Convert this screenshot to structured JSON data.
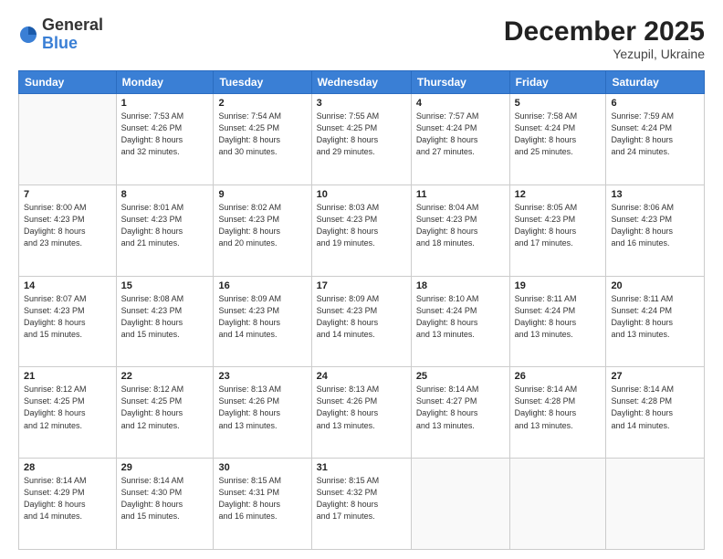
{
  "header": {
    "logo_general": "General",
    "logo_blue": "Blue",
    "month": "December 2025",
    "location": "Yezupil, Ukraine"
  },
  "days_of_week": [
    "Sunday",
    "Monday",
    "Tuesday",
    "Wednesday",
    "Thursday",
    "Friday",
    "Saturday"
  ],
  "weeks": [
    [
      {
        "day": "",
        "info": ""
      },
      {
        "day": "1",
        "info": "Sunrise: 7:53 AM\nSunset: 4:26 PM\nDaylight: 8 hours\nand 32 minutes."
      },
      {
        "day": "2",
        "info": "Sunrise: 7:54 AM\nSunset: 4:25 PM\nDaylight: 8 hours\nand 30 minutes."
      },
      {
        "day": "3",
        "info": "Sunrise: 7:55 AM\nSunset: 4:25 PM\nDaylight: 8 hours\nand 29 minutes."
      },
      {
        "day": "4",
        "info": "Sunrise: 7:57 AM\nSunset: 4:24 PM\nDaylight: 8 hours\nand 27 minutes."
      },
      {
        "day": "5",
        "info": "Sunrise: 7:58 AM\nSunset: 4:24 PM\nDaylight: 8 hours\nand 25 minutes."
      },
      {
        "day": "6",
        "info": "Sunrise: 7:59 AM\nSunset: 4:24 PM\nDaylight: 8 hours\nand 24 minutes."
      }
    ],
    [
      {
        "day": "7",
        "info": ""
      },
      {
        "day": "8",
        "info": "Sunrise: 8:01 AM\nSunset: 4:23 PM\nDaylight: 8 hours\nand 21 minutes."
      },
      {
        "day": "9",
        "info": "Sunrise: 8:02 AM\nSunset: 4:23 PM\nDaylight: 8 hours\nand 20 minutes."
      },
      {
        "day": "10",
        "info": "Sunrise: 8:03 AM\nSunset: 4:23 PM\nDaylight: 8 hours\nand 19 minutes."
      },
      {
        "day": "11",
        "info": "Sunrise: 8:04 AM\nSunset: 4:23 PM\nDaylight: 8 hours\nand 18 minutes."
      },
      {
        "day": "12",
        "info": "Sunrise: 8:05 AM\nSunset: 4:23 PM\nDaylight: 8 hours\nand 17 minutes."
      },
      {
        "day": "13",
        "info": "Sunrise: 8:06 AM\nSunset: 4:23 PM\nDaylight: 8 hours\nand 16 minutes."
      }
    ],
    [
      {
        "day": "14",
        "info": "Sunrise: 8:07 AM\nSunset: 4:23 PM\nDaylight: 8 hours\nand 15 minutes."
      },
      {
        "day": "15",
        "info": "Sunrise: 8:08 AM\nSunset: 4:23 PM\nDaylight: 8 hours\nand 15 minutes."
      },
      {
        "day": "16",
        "info": "Sunrise: 8:09 AM\nSunset: 4:23 PM\nDaylight: 8 hours\nand 14 minutes."
      },
      {
        "day": "17",
        "info": "Sunrise: 8:09 AM\nSunset: 4:23 PM\nDaylight: 8 hours\nand 14 minutes."
      },
      {
        "day": "18",
        "info": "Sunrise: 8:10 AM\nSunset: 4:24 PM\nDaylight: 8 hours\nand 13 minutes."
      },
      {
        "day": "19",
        "info": "Sunrise: 8:11 AM\nSunset: 4:24 PM\nDaylight: 8 hours\nand 13 minutes."
      },
      {
        "day": "20",
        "info": "Sunrise: 8:11 AM\nSunset: 4:24 PM\nDaylight: 8 hours\nand 13 minutes."
      }
    ],
    [
      {
        "day": "21",
        "info": "Sunrise: 8:12 AM\nSunset: 4:25 PM\nDaylight: 8 hours\nand 12 minutes."
      },
      {
        "day": "22",
        "info": "Sunrise: 8:12 AM\nSunset: 4:25 PM\nDaylight: 8 hours\nand 12 minutes."
      },
      {
        "day": "23",
        "info": "Sunrise: 8:13 AM\nSunset: 4:26 PM\nDaylight: 8 hours\nand 13 minutes."
      },
      {
        "day": "24",
        "info": "Sunrise: 8:13 AM\nSunset: 4:26 PM\nDaylight: 8 hours\nand 13 minutes."
      },
      {
        "day": "25",
        "info": "Sunrise: 8:14 AM\nSunset: 4:27 PM\nDaylight: 8 hours\nand 13 minutes."
      },
      {
        "day": "26",
        "info": "Sunrise: 8:14 AM\nSunset: 4:28 PM\nDaylight: 8 hours\nand 13 minutes."
      },
      {
        "day": "27",
        "info": "Sunrise: 8:14 AM\nSunset: 4:28 PM\nDaylight: 8 hours\nand 14 minutes."
      }
    ],
    [
      {
        "day": "28",
        "info": "Sunrise: 8:14 AM\nSunset: 4:29 PM\nDaylight: 8 hours\nand 14 minutes."
      },
      {
        "day": "29",
        "info": "Sunrise: 8:14 AM\nSunset: 4:30 PM\nDaylight: 8 hours\nand 15 minutes."
      },
      {
        "day": "30",
        "info": "Sunrise: 8:15 AM\nSunset: 4:31 PM\nDaylight: 8 hours\nand 16 minutes."
      },
      {
        "day": "31",
        "info": "Sunrise: 8:15 AM\nSunset: 4:32 PM\nDaylight: 8 hours\nand 17 minutes."
      },
      {
        "day": "",
        "info": ""
      },
      {
        "day": "",
        "info": ""
      },
      {
        "day": "",
        "info": ""
      }
    ]
  ]
}
